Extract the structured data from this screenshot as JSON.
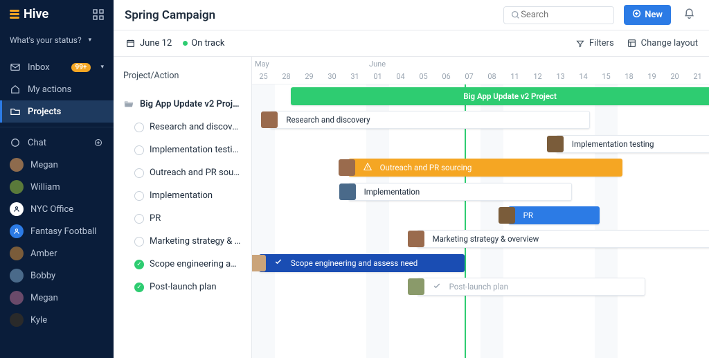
{
  "brand": "Hive",
  "status_prompt": "What's your status?",
  "nav": {
    "inbox": "Inbox",
    "inbox_badge": "99+",
    "my_actions": "My actions",
    "projects": "Projects",
    "chat": "Chat"
  },
  "people": [
    {
      "name": "Megan",
      "color": "#8e6b4d"
    },
    {
      "name": "William",
      "color": "#5a7a3a"
    },
    {
      "name": "NYC Office",
      "color": "#ffffff",
      "text": "#0a1d3a",
      "icon": true
    },
    {
      "name": "Fantasy Football",
      "color": "#2c7be5",
      "icon": true
    },
    {
      "name": "Amber",
      "color": "#7a5c3a"
    },
    {
      "name": "Bobby",
      "color": "#4a6a8a"
    },
    {
      "name": "Megan",
      "color": "#6a4a6a"
    },
    {
      "name": "Kyle",
      "color": "#2a2a2a"
    }
  ],
  "page_title": "Spring Campaign",
  "search_placeholder": "Search",
  "new_label": "New",
  "subbar": {
    "date": "June 12",
    "status": "On track",
    "filters": "Filters",
    "change_layout": "Change layout"
  },
  "panel_head": "Project/Action",
  "project_name": "Big App Update v2 Project",
  "tasks": [
    {
      "label": "Research and discovery",
      "done": false
    },
    {
      "label": "Implementation testing",
      "done": false
    },
    {
      "label": "Outreach and PR sourcing",
      "done": false
    },
    {
      "label": "Implementation",
      "done": false
    },
    {
      "label": "PR",
      "done": false
    },
    {
      "label": "Marketing strategy & over",
      "done": false
    },
    {
      "label": "Scope engineering and as",
      "done": true
    },
    {
      "label": "Post-launch plan",
      "done": true
    }
  ],
  "timeline": {
    "months": [
      {
        "label": "May",
        "at": 0
      },
      {
        "label": "June",
        "at": 5
      }
    ],
    "days": [
      "25",
      "28",
      "29",
      "30",
      "31",
      "01",
      "04",
      "05",
      "06",
      "07",
      "08",
      "11",
      "12",
      "13",
      "14",
      "15",
      "18",
      "19",
      "20",
      "21"
    ],
    "weekend_cols": [
      0,
      5,
      10,
      15
    ],
    "today_col": 9.3
  },
  "bars": [
    {
      "row": 0,
      "start": 1.7,
      "span": 19,
      "style": "green",
      "label": "Big App Update v2 Project",
      "no_avatar": true,
      "center": true
    },
    {
      "row": 1,
      "start": 0.8,
      "span": 14,
      "style": "white",
      "label": "Research and discovery",
      "avatar": "#9a6b4d"
    },
    {
      "row": 2,
      "start": 13.3,
      "span": 7,
      "style": "white",
      "label": "Implementation testing",
      "avatar": "#7a5c3a"
    },
    {
      "row": 3,
      "start": 4.2,
      "span": 12,
      "style": "orange",
      "label": "Outreach and PR sourcing",
      "avatar": "#9a6b4d",
      "icon": "warn"
    },
    {
      "row": 4,
      "start": 4.2,
      "span": 9.8,
      "style": "white",
      "label": "Implementation",
      "avatar": "#4a6a8a"
    },
    {
      "row": 5,
      "start": 11.2,
      "span": 4,
      "style": "blue",
      "label": "PR",
      "avatar": "#7a5c3a"
    },
    {
      "row": 6,
      "start": 7.2,
      "span": 13,
      "style": "white",
      "label": "Marketing strategy & overview",
      "avatar": "#9a6b4d"
    },
    {
      "row": 7,
      "start": 0.3,
      "span": 9,
      "style": "darkblue",
      "label": "Scope engineering and assess need",
      "avatar": "#caa47a",
      "icon": "check"
    },
    {
      "row": 8,
      "start": 7.2,
      "span": 10,
      "style": "white muted",
      "label": "Post-launch plan",
      "avatar": "#8a9a6a",
      "icon": "check-muted"
    }
  ]
}
